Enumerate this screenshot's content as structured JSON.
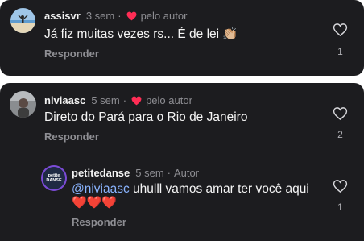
{
  "comments": [
    {
      "username": "assisvr",
      "time": "3 sem",
      "separator": "·",
      "author_liked_label": "pelo autor",
      "text": "Já fiz muitas vezes rs... É de lei",
      "emoji": "👏🏼",
      "reply_label": "Responder",
      "likes": "1"
    },
    {
      "username": "niviaasc",
      "time": "5 sem",
      "separator": "·",
      "author_liked_label": "pelo autor",
      "text": "Direto do Pará para o Rio de Janeiro",
      "reply_label": "Responder",
      "likes": "2"
    }
  ],
  "replies": [
    {
      "username": "petitedanse",
      "time": "5 sem",
      "separator": "·",
      "author_tag": "Autor",
      "avatar_text": "petite DANSE",
      "mention": "@niviaasc",
      "text": " uhulll vamos amar ter você aqui",
      "emoji": "❤️❤️❤️",
      "reply_label": "Responder",
      "likes": "1"
    }
  ],
  "colors": {
    "card_bg": "#1c1c1f",
    "author_heart": "#ff2d55",
    "emoji_heart": "#ff3b4e",
    "mention": "#8ab4ff",
    "avatar_ring": "#7b4bd6"
  }
}
